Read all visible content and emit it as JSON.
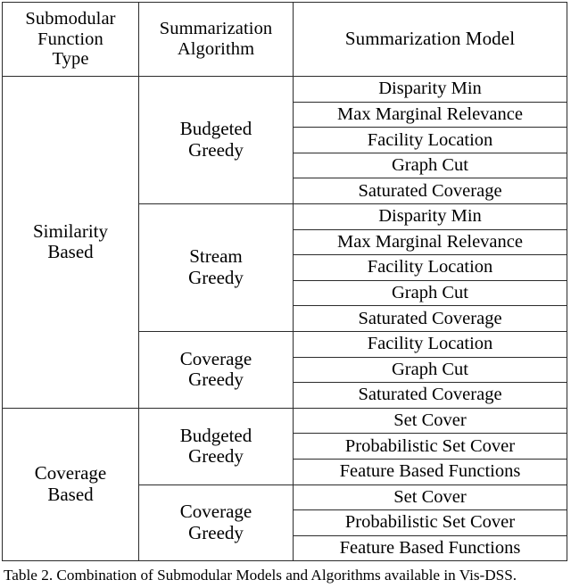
{
  "table": {
    "headers": {
      "col1": "Submodular Function Type",
      "col1_lines": [
        "Submodular",
        "Function",
        "Type"
      ],
      "col2": "Summarization Algorithm",
      "col2_lines": [
        "Summarization",
        "Algorithm"
      ],
      "col3": "Summarization Model"
    },
    "groups": [
      {
        "type": "Similarity Based",
        "type_lines": [
          "Similarity",
          "Based"
        ],
        "algorithms": [
          {
            "name": "Budgeted Greedy",
            "name_lines": [
              "Budgeted",
              "Greedy"
            ],
            "models": [
              "Disparity Min",
              "Max Marginal Relevance",
              "Facility Location",
              "Graph Cut",
              "Saturated Coverage"
            ]
          },
          {
            "name": "Stream Greedy",
            "name_lines": [
              "Stream",
              "Greedy"
            ],
            "models": [
              "Disparity Min",
              "Max Marginal Relevance",
              "Facility Location",
              "Graph Cut",
              "Saturated Coverage"
            ]
          },
          {
            "name": "Coverage Greedy",
            "name_lines": [
              "Coverage",
              "Greedy"
            ],
            "models": [
              "Facility Location",
              "Graph Cut",
              "Saturated Coverage"
            ]
          }
        ]
      },
      {
        "type": "Coverage Based",
        "type_lines": [
          "Coverage",
          "Based"
        ],
        "algorithms": [
          {
            "name": "Budgeted Greedy",
            "name_lines": [
              "Budgeted",
              "Greedy"
            ],
            "models": [
              "Set Cover",
              "Probabilistic Set Cover",
              "Feature Based Functions"
            ]
          },
          {
            "name": "Coverage Greedy",
            "name_lines": [
              "Coverage",
              "Greedy"
            ],
            "models": [
              "Set Cover",
              "Probabilistic Set Cover",
              "Feature Based Functions"
            ]
          }
        ]
      }
    ]
  },
  "caption": {
    "label": "Table 2.",
    "text": "Table 2. Combination of Submodular Models and Algorithms available in Vis-DSS."
  },
  "colors": {
    "border": "#2b2b2b",
    "text": "#000000",
    "background": "#ffffff"
  }
}
